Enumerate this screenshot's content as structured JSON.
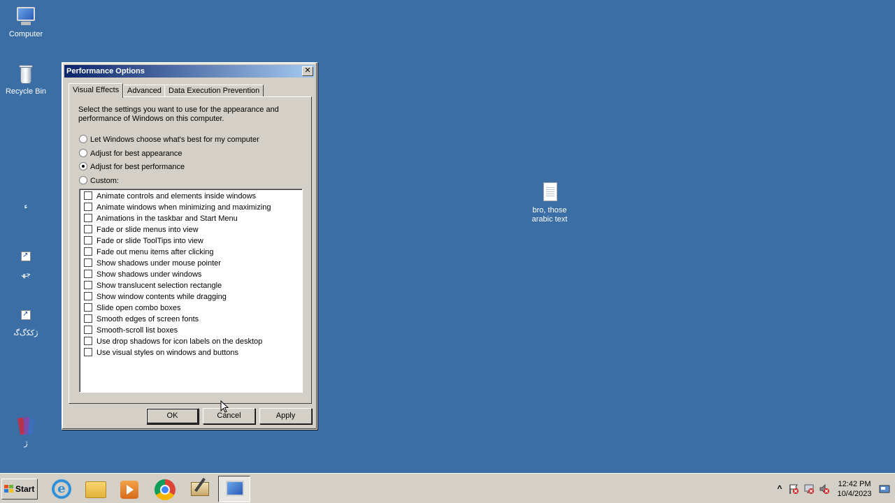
{
  "desktop": {
    "icons": [
      {
        "label": "Computer"
      },
      {
        "label": "Recycle Bin"
      },
      {
        "label": "ء"
      },
      {
        "label": "ﺟﮫ"
      },
      {
        "label": "ﮊﮐﮑﮒﮔﮦ"
      },
      {
        "label": "ﮊ"
      },
      {
        "label": "bro, those arabic text"
      }
    ]
  },
  "dialog": {
    "title": "Performance Options",
    "close_glyph": "✕",
    "tabs": [
      {
        "label": "Visual Effects",
        "active": true
      },
      {
        "label": "Advanced",
        "active": false
      },
      {
        "label": "Data Execution Prevention",
        "active": false
      }
    ],
    "intro": "Select the settings you want to use for the appearance and performance of Windows on this computer.",
    "radios": [
      {
        "label": "Let Windows choose what's best for my computer",
        "checked": false
      },
      {
        "label": "Adjust for best appearance",
        "checked": false
      },
      {
        "label": "Adjust for best performance",
        "checked": true
      },
      {
        "label": "Custom:",
        "checked": false
      }
    ],
    "options": [
      {
        "label": "Animate controls and elements inside windows",
        "checked": false
      },
      {
        "label": "Animate windows when minimizing and maximizing",
        "checked": false
      },
      {
        "label": "Animations in the taskbar and Start Menu",
        "checked": false
      },
      {
        "label": "Fade or slide menus into view",
        "checked": false
      },
      {
        "label": "Fade or slide ToolTips into view",
        "checked": false
      },
      {
        "label": "Fade out menu items after clicking",
        "checked": false
      },
      {
        "label": "Show shadows under mouse pointer",
        "checked": false
      },
      {
        "label": "Show shadows under windows",
        "checked": false
      },
      {
        "label": "Show translucent selection rectangle",
        "checked": false
      },
      {
        "label": "Show window contents while dragging",
        "checked": false
      },
      {
        "label": "Slide open combo boxes",
        "checked": false
      },
      {
        "label": "Smooth edges of screen fonts",
        "checked": false
      },
      {
        "label": "Smooth-scroll list boxes",
        "checked": false
      },
      {
        "label": "Use drop shadows for icon labels on the desktop",
        "checked": false
      },
      {
        "label": "Use visual styles on windows and buttons",
        "checked": false
      }
    ],
    "buttons": {
      "ok": "OK",
      "cancel": "Cancel",
      "apply": "Apply"
    }
  },
  "taskbar": {
    "start_label": "Start",
    "apps": [
      {
        "name": "internet-explorer"
      },
      {
        "name": "file-explorer"
      },
      {
        "name": "media-player"
      },
      {
        "name": "chrome"
      },
      {
        "name": "pen-tablet"
      },
      {
        "name": "performance-options",
        "active": true
      }
    ],
    "tray": {
      "expand_glyph": "^",
      "time": "12:42 PM",
      "date": "10/4/2023"
    }
  },
  "colors": {
    "desktop": "#3a6ea5",
    "title_start": "#0a246a",
    "title_end": "#a6caf0",
    "chrome": "#d4d0c8"
  }
}
